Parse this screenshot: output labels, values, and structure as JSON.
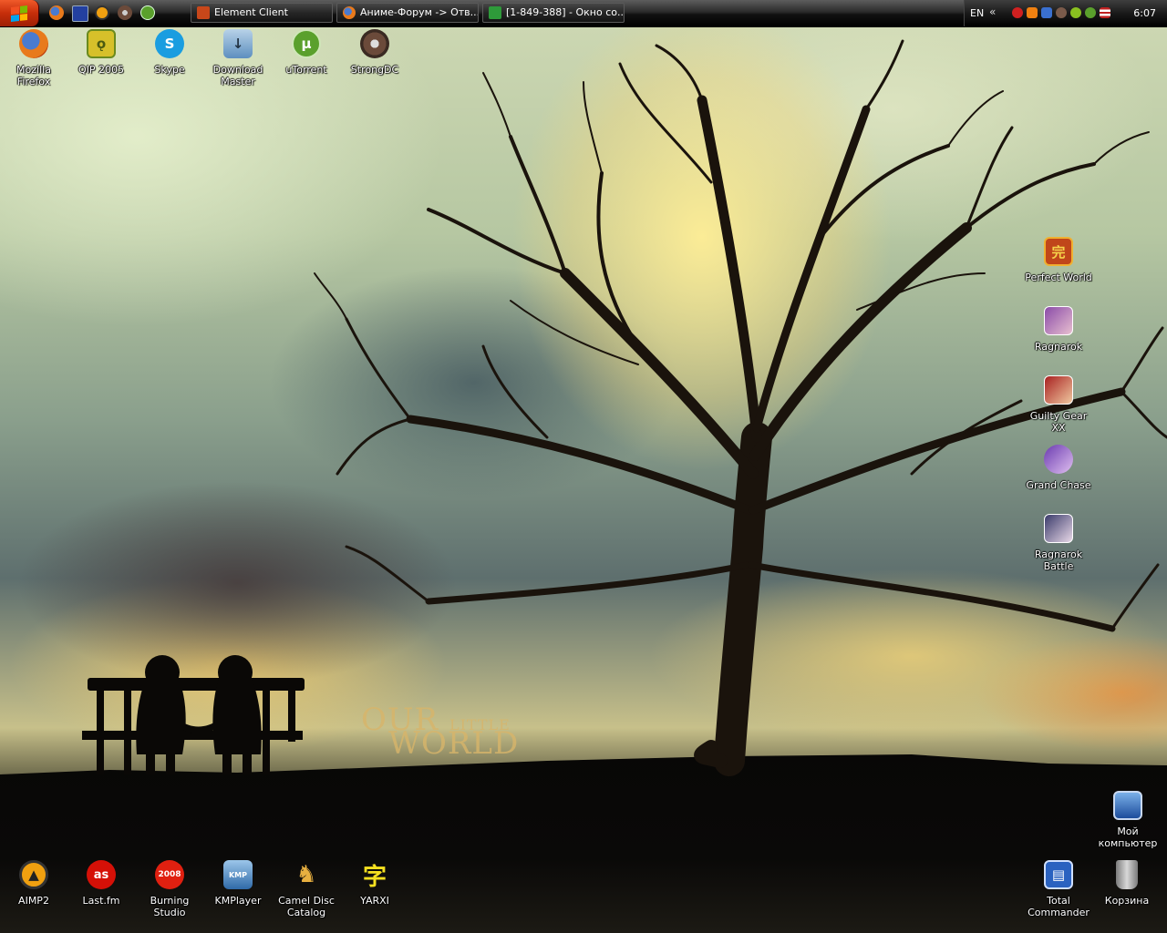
{
  "taskbar": {
    "tasks": [
      {
        "label": "Element Client",
        "color": "#c8471a"
      },
      {
        "label": "Аниме-Форум -> Отв...",
        "color": "#e07a1a"
      },
      {
        "label": "[1-849-388] - Окно со...",
        "color": "#2e9a3a"
      }
    ],
    "quick_launch": [
      "firefox-icon",
      "display-icon",
      "aimp-icon",
      "strongdc-icon",
      "utorrent-icon"
    ]
  },
  "tray": {
    "lang": "EN",
    "arrows": "«",
    "clock": "6:07",
    "icons": [
      "opera-icon",
      "media-icon",
      "network-icon",
      "strongdc-icon",
      "alien-icon",
      "utorrent-icon",
      "flag-icon"
    ]
  },
  "desktop": {
    "top_icons": [
      {
        "label": "Mozilla Firefox",
        "icon": "firefox-icon"
      },
      {
        "label": "QIP 2005",
        "icon": "qip-icon"
      },
      {
        "label": "Skype",
        "icon": "skype-icon"
      },
      {
        "label": "Download Master",
        "icon": "download-master-icon"
      },
      {
        "label": "uTorrent",
        "icon": "utorrent-icon"
      },
      {
        "label": "StrongDC",
        "icon": "strongdc-icon"
      }
    ],
    "right_icons": [
      {
        "label": "Perfect World",
        "icon": "perfect-world-icon"
      },
      {
        "label": "Ragnarok",
        "icon": "ragnarok-icon"
      },
      {
        "label": "Guilty Gear XX",
        "icon": "guilty-gear-icon"
      },
      {
        "label": "Grand Chase",
        "icon": "grand-chase-icon"
      },
      {
        "label": "Ragnarok Battle",
        "icon": "ragnarok-battle-icon"
      }
    ],
    "bottom_icons": [
      {
        "label": "AIMP2",
        "icon": "aimp-icon"
      },
      {
        "label": "Last.fm",
        "icon": "lastfm-icon"
      },
      {
        "label": "Burning Studio",
        "icon": "burning-studio-icon"
      },
      {
        "label": "KMPlayer",
        "icon": "kmplayer-icon"
      },
      {
        "label": "Camel Disc Catalog",
        "icon": "camel-icon"
      },
      {
        "label": "YARXI",
        "icon": "yarxi-icon"
      }
    ],
    "system_icons": [
      {
        "label": "Мой компьютер",
        "icon": "my-computer-icon"
      },
      {
        "label": "Total Commander",
        "icon": "total-commander-icon"
      },
      {
        "label": "Корзина",
        "icon": "recycle-bin-icon"
      }
    ]
  },
  "wallpaper": {
    "line1": "OUR",
    "line1_small": "LITTLE",
    "line2": "WORLD"
  }
}
